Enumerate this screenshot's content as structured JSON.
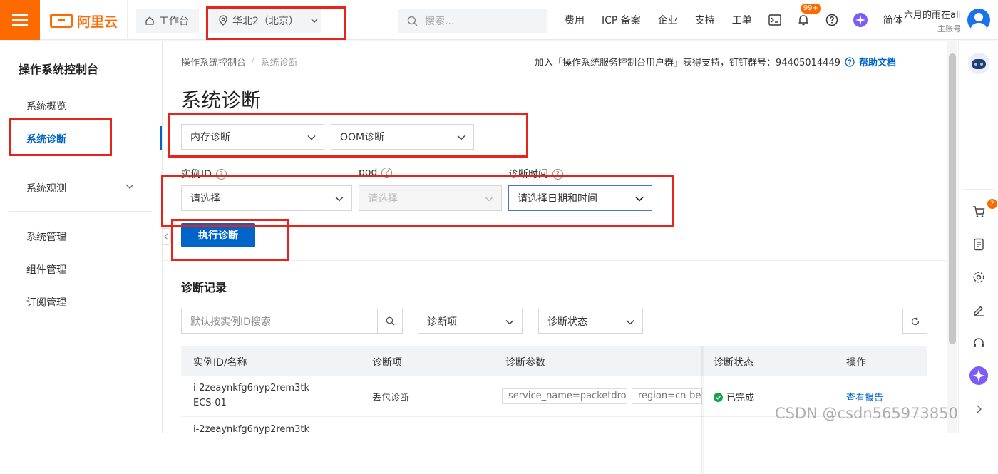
{
  "topbar": {
    "logo_text": "阿里云",
    "workbench_label": "工作台",
    "region_label": "华北2（北京）",
    "search_placeholder": "搜索...",
    "nav": [
      "费用",
      "ICP 备案",
      "企业",
      "支持",
      "工单"
    ],
    "notification_badge": "99+",
    "language": "简体",
    "user_name": "六月的雨在ali",
    "user_role": "主账号"
  },
  "sidebar": {
    "title": "操作系统控制台",
    "items": [
      "系统概览",
      "系统诊断",
      "系统观测",
      "系统管理",
      "组件管理",
      "订阅管理"
    ],
    "active": "系统诊断"
  },
  "main": {
    "breadcrumb": [
      "操作系统控制台",
      "系统诊断"
    ],
    "notice": "加入「操作系统服务控制台用户群」获得支持，钉钉群号：94405014449",
    "help_link": "帮助文档",
    "title": "系统诊断",
    "diag_type": "内存诊断",
    "diag_item": "OOM诊断",
    "fields": {
      "instance_label": "实例ID",
      "instance_placeholder": "请选择",
      "pod_label": "pod",
      "pod_placeholder": "请选择",
      "time_label": "诊断时间",
      "time_placeholder": "请选择日期和时间"
    },
    "run_button": "执行诊断",
    "records_title": "诊断记录",
    "record_search_placeholder": "默认按实例ID搜索",
    "filter_item": "诊断项",
    "filter_status": "诊断状态",
    "table": {
      "headers": [
        "实例ID/名称",
        "诊断项",
        "诊断参数",
        "诊断状态",
        "操作"
      ],
      "rows": [
        {
          "instance_id": "i-2zeaynkfg6nyp2rem3tk",
          "instance_name": "ECS-01",
          "item": "丢包诊断",
          "params": [
            "service_name=packetdrop",
            "region=cn-bei"
          ],
          "status": "已完成",
          "action": "查看报告"
        },
        {
          "instance_id": "i-2zeaynkfg6nyp2rem3tk"
        }
      ]
    }
  },
  "rightbar": {
    "cart_badge": "2"
  },
  "watermark": "CSDN @csdn565973850",
  "colors": {
    "brand_orange": "#ff6a00",
    "primary_blue": "#0064c8",
    "highlight_red": "#e8231a",
    "success_green": "#17a34a"
  }
}
